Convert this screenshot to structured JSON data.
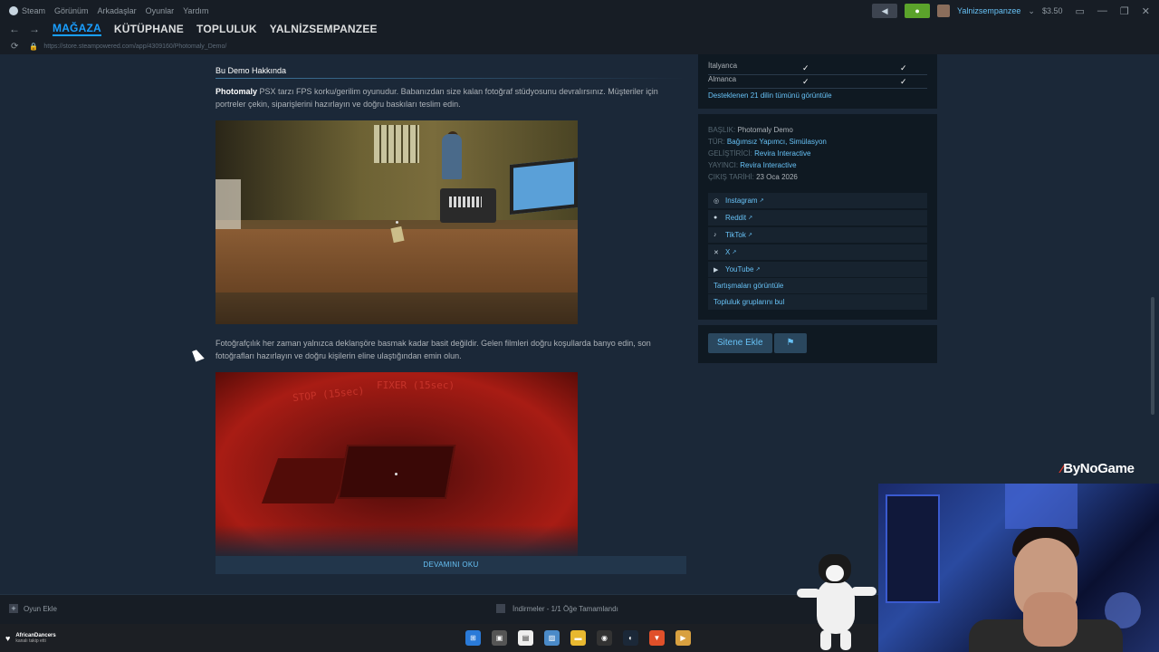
{
  "menubar": {
    "app": "Steam",
    "items": [
      "Görünüm",
      "Arkadaşlar",
      "Oyunlar",
      "Yardım"
    ]
  },
  "account": {
    "name": "Yalnizsempanzee",
    "balance": "$3.50",
    "chevron": "⌄"
  },
  "nav": {
    "tabs": [
      "MAĞAZA",
      "KÜTÜPHANE",
      "TOPLULUK",
      "YALNİZSEMPANZEE"
    ]
  },
  "url": "https://store.steampowered.com/app/4309160/Photomaly_Demo/",
  "about": {
    "title": "Bu Demo Hakkında",
    "intro_bold": "Photomaly",
    "intro_rest": " PSX tarzı FPS korku/gerilim oyunudur. Babanızdan size kalan fotoğraf stüdyosunu devralırsınız. Müşteriler için portreler çekin, siparişlerini hazırlayın ve doğru baskıları teslim edin.",
    "para2": "Fotoğrafçılık her zaman yalnızca deklanşöre basmak kadar basit değildir. Gelen filmleri doğru koşullarda banyo edin, son fotoğrafları hazırlayın ve doğru kişilerin eline ulaştığından emin olun.",
    "shot2_text1": "STOP (15sec)",
    "shot2_text2": "FIXER (15sec)",
    "read_more": "DEVAMINI OKU"
  },
  "languages": {
    "rows": [
      {
        "name": "İtalyanca",
        "ui": "✓",
        "sub": "✓"
      },
      {
        "name": "Almanca",
        "ui": "✓",
        "sub": "✓"
      }
    ],
    "link": "Desteklenen 21 dilin tümünü görüntüle"
  },
  "details": {
    "title_label": "BAŞLIK:",
    "title_value": "Photomaly Demo",
    "genre_label": "TÜR:",
    "genre_value": "Bağımsız Yapımcı, Simülasyon",
    "dev_label": "GELİŞTİRİCİ:",
    "dev_value": "Revira Interactive",
    "pub_label": "YAYINCI:",
    "pub_value": "Revira Interactive",
    "date_label": "ÇIKIŞ TARİHİ:",
    "date_value": "23 Oca 2026"
  },
  "social": {
    "instagram": "Instagram",
    "reddit": "Reddit",
    "tiktok": "TikTok",
    "x": "X",
    "youtube": "YouTube",
    "discussions": "Tartışmaları görüntüle",
    "groups": "Topluluk gruplarını bul"
  },
  "actions": {
    "add_site": "Sitene Ekle",
    "flag_icon": "flag-icon"
  },
  "bottombar": {
    "add_game": "Oyun Ekle",
    "downloads": "İndirmeler - 1/1 Öğe Tamamlandı"
  },
  "taskbar": {
    "notif_title": "AfricanDancers",
    "notif_sub": "kanalı takip etti"
  },
  "overlay": {
    "brand": "ByNoGame"
  },
  "colors": {
    "accent": "#1a9fff",
    "link": "#67c1f5",
    "bg": "#1b2838"
  }
}
